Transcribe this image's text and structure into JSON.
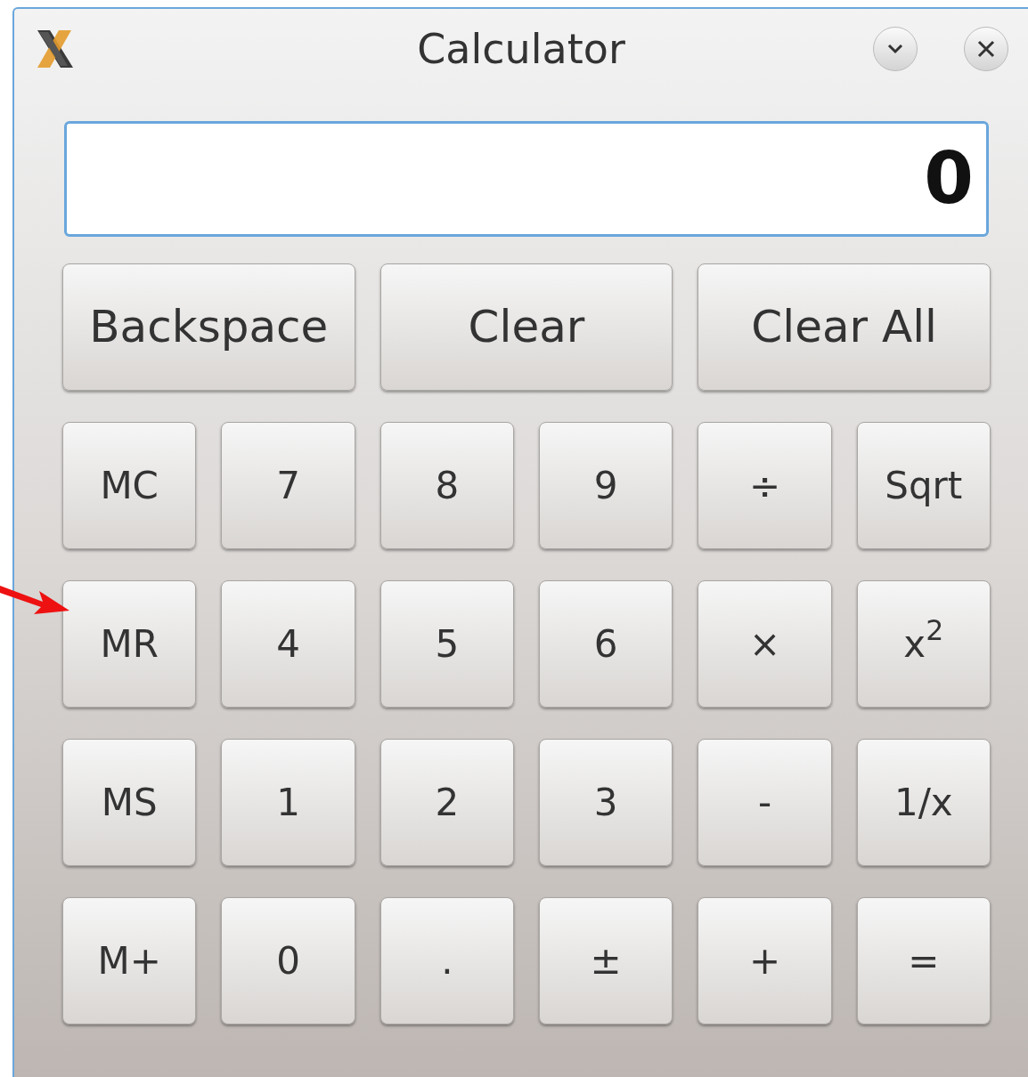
{
  "window": {
    "title": "Calculator"
  },
  "display": {
    "value": "0"
  },
  "top_buttons": [
    "Backspace",
    "Clear",
    "Clear All"
  ],
  "keypad": [
    [
      "MC",
      "7",
      "8",
      "9",
      "÷",
      "Sqrt"
    ],
    [
      "MR",
      "4",
      "5",
      "6",
      "×",
      "x$^{2}$"
    ],
    [
      "MS",
      "1",
      "2",
      "3",
      "-",
      "1/x"
    ],
    [
      "M+",
      "0",
      ".",
      "±",
      "+",
      "="
    ]
  ]
}
